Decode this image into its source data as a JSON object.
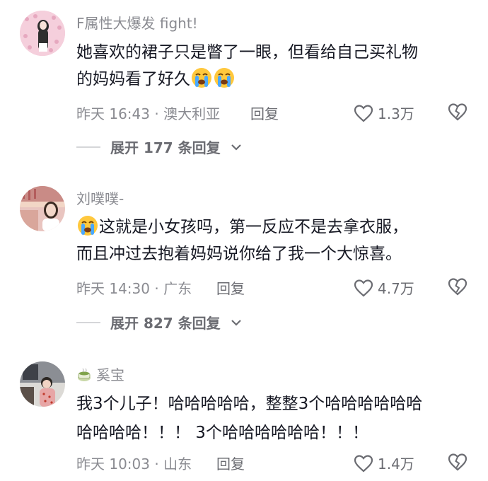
{
  "comments": [
    {
      "username": "F属性大爆发 fight!",
      "text_line1": "她喜欢的裙子只是瞥了一眼，但看给自己买礼物",
      "text_line2": "的妈妈看了好久",
      "emoji": "crying-face-icon",
      "time_location": "昨天 16:43 · 澳大利亚",
      "reply_label": "回复",
      "likes": "1.3万",
      "expand_label": "展开 177 条回复"
    },
    {
      "username": "刘噗噗-",
      "emoji": "crying-face-icon",
      "text_line1": "这就是小女孩吗，第一反应不是去拿衣服，",
      "text_line2": "而且冲过去抱着妈妈说你给了我一个大惊喜。",
      "time_location": "昨天 14:30 · 广东",
      "reply_label": "回复",
      "likes": "4.7万",
      "expand_label": "展开 827 条回复"
    },
    {
      "username": "奚宝",
      "badge_icon": "teacup-icon",
      "text_line1": "我3个儿子！哈哈哈哈哈，整整3个哈哈哈哈哈哈",
      "text_line2": "哈哈哈哈！！！ 3个哈哈哈哈哈哈！！！",
      "time_location": "昨天 10:03 · 山东",
      "reply_label": "回复",
      "likes": "1.4万"
    }
  ],
  "colors": {
    "text_primary": "#161823",
    "text_secondary": "#8a8b91",
    "divider": "#d5d6d9"
  }
}
